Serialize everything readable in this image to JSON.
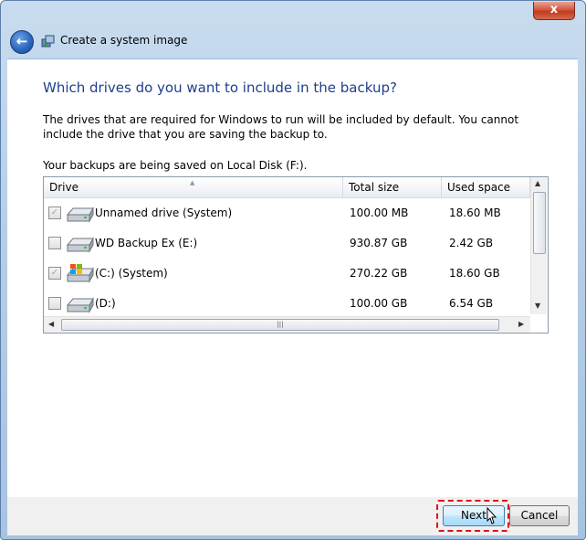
{
  "window": {
    "title": "Create a system image",
    "close_label": "x"
  },
  "main": {
    "heading": "Which drives do you want to include in the backup?",
    "description": "The drives that are required for Windows to run will be included by default. You cannot include the drive that you are saving the backup to.",
    "saving_location": "Your backups are being saved on Local Disk (F:)."
  },
  "drives_table": {
    "columns": [
      "Drive",
      "Total size",
      "Used space"
    ],
    "rows": [
      {
        "name": "Unnamed drive (System)",
        "total_size": "100.00 MB",
        "used_space": "18.60 MB",
        "checked": true,
        "disabled": true,
        "icon": "hard-drive-icon"
      },
      {
        "name": "WD Backup Ex  (E:)",
        "total_size": "930.87 GB",
        "used_space": "2.42 GB",
        "checked": false,
        "disabled": false,
        "icon": "hard-drive-icon"
      },
      {
        "name": "(C:) (System)",
        "total_size": "270.22 GB",
        "used_space": "18.60 GB",
        "checked": true,
        "disabled": true,
        "icon": "windows-drive-icon"
      },
      {
        "name": "(D:)",
        "total_size": "100.00 GB",
        "used_space": "6.54 GB",
        "checked": false,
        "disabled": false,
        "icon": "hard-drive-icon"
      }
    ]
  },
  "footer": {
    "next_label": "Next",
    "cancel_label": "Cancel"
  },
  "colors": {
    "heading": "#1e3f8a",
    "highlight_border": "#e0101a"
  }
}
